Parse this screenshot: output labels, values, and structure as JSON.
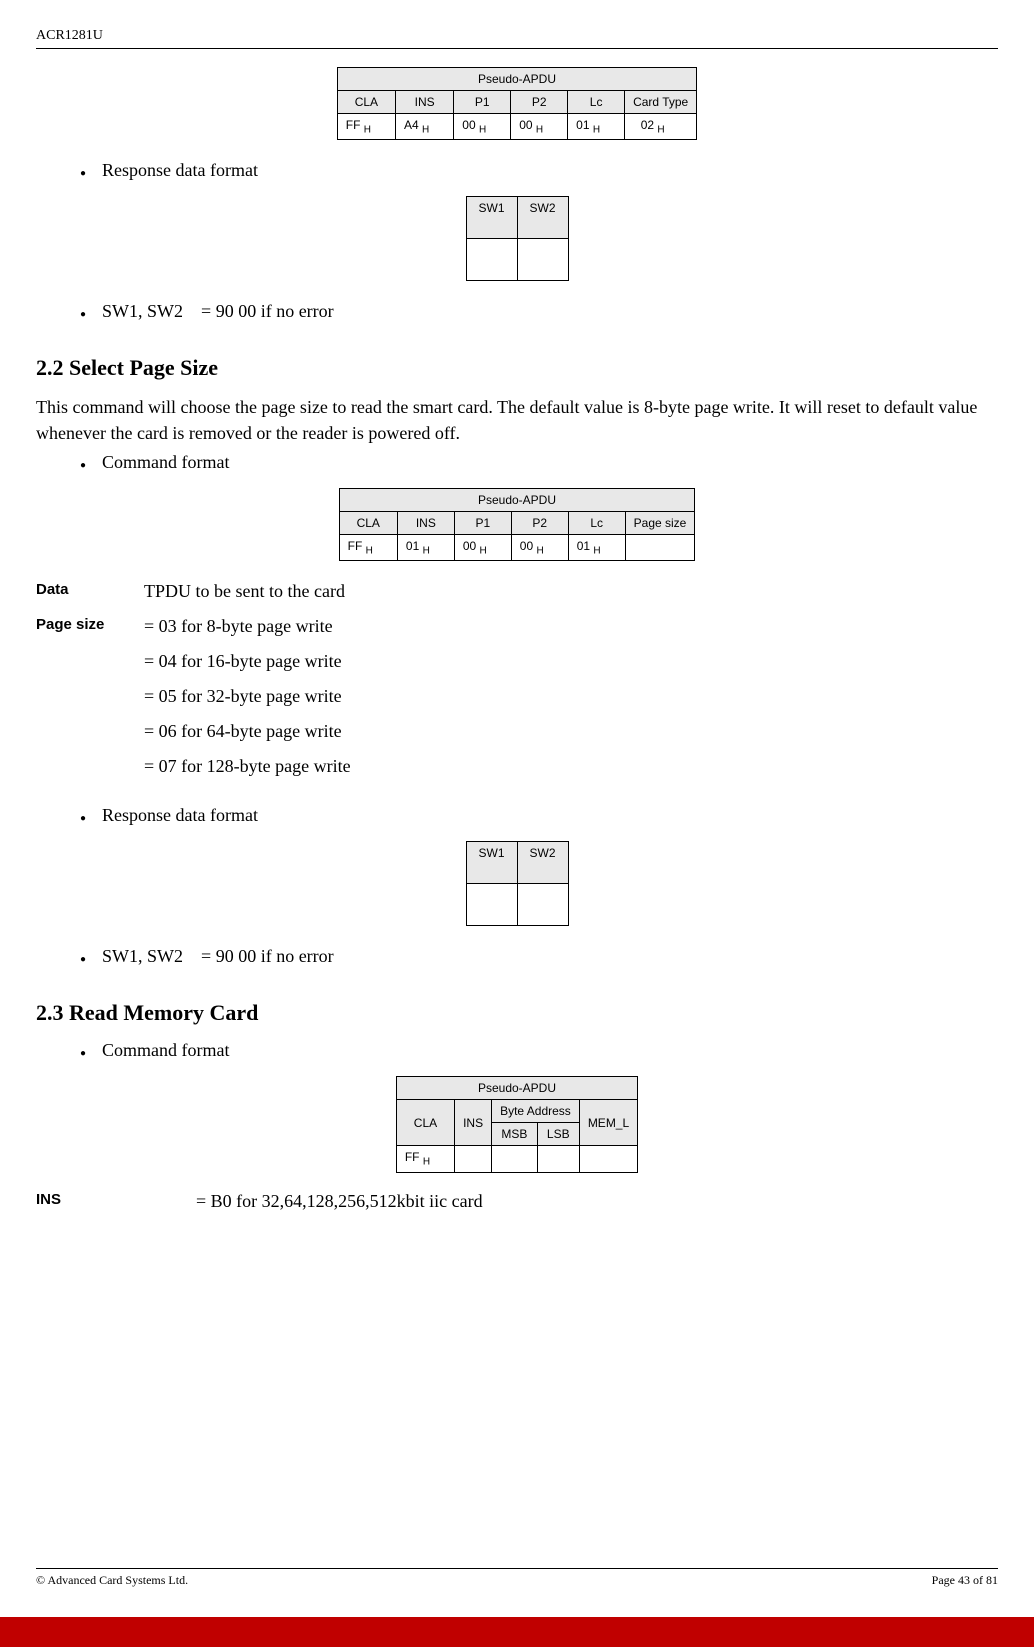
{
  "header": {
    "model": "ACR1281U"
  },
  "table1": {
    "title": "Pseudo-APDU",
    "cols": [
      "CLA",
      "INS",
      "P1",
      "P2",
      "Lc",
      "Card Type"
    ],
    "row": [
      "FF",
      "A4",
      "00",
      "00",
      "01",
      "02"
    ]
  },
  "bullets": {
    "respFormat": "Response data format",
    "swNoError": "SW1, SW2",
    "swNoErrorVal": "= 90 00 if no error",
    "swNoErrorVal2": "= 90  00  if no error",
    "cmdFormat": "Command format"
  },
  "swTable": {
    "h1": "SW1",
    "h2": "SW2"
  },
  "sec22": {
    "title": "2.2 Select Page Size",
    "para": "This command will choose the page size to read the smart card. The default value is 8-byte page write. It will reset to default value whenever the card is removed or the reader is powered off."
  },
  "table2": {
    "title": "Pseudo-APDU",
    "cols": [
      "CLA",
      "INS",
      "P1",
      "P2",
      "Lc",
      "Page size"
    ],
    "row": [
      "FF",
      "01",
      "00",
      "00",
      "01",
      ""
    ]
  },
  "defs": {
    "data": {
      "label": "Data",
      "text": "TPDU to be sent to the card"
    },
    "pagesize": {
      "label": "Page size",
      "lines": [
        "= 03  for 8-byte page write",
        "= 04  for 16-byte page write",
        "= 05  for 32-byte page write",
        "= 06  for 64-byte page write",
        "= 07  for 128-byte page write"
      ]
    },
    "ins": {
      "label": "INS",
      "text": "= B0  for 32,64,128,256,512kbit iic card"
    }
  },
  "sec23": {
    "title": "2.3 Read Memory Card"
  },
  "table3": {
    "title": "Pseudo-APDU",
    "cols": {
      "cla": "CLA",
      "ins": "INS",
      "byteaddr": "Byte Address",
      "meml": "MEM_L",
      "msb": "MSB",
      "lsb": "LSB"
    },
    "row": {
      "cla": "FF"
    }
  },
  "footer": {
    "left": "© Advanced Card Systems Ltd.",
    "right": "Page 43 of 81"
  }
}
